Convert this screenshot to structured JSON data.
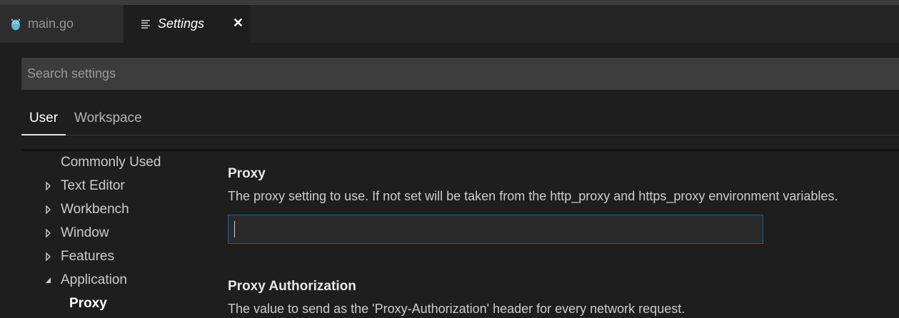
{
  "tabs": {
    "main": {
      "label": "main.go",
      "icon": "go-gopher-icon"
    },
    "settings": {
      "label": "Settings",
      "icon": "settings-lines-icon",
      "close": "✕"
    }
  },
  "search": {
    "placeholder": "Search settings",
    "value": ""
  },
  "scopes": {
    "user": "User",
    "workspace": "Workspace",
    "active": "User"
  },
  "toc": [
    {
      "label": "Commonly Used",
      "expandable": false
    },
    {
      "label": "Text Editor",
      "expandable": true,
      "expanded": false
    },
    {
      "label": "Workbench",
      "expandable": true,
      "expanded": false
    },
    {
      "label": "Window",
      "expandable": true,
      "expanded": false
    },
    {
      "label": "Features",
      "expandable": true,
      "expanded": false
    },
    {
      "label": "Application",
      "expandable": true,
      "expanded": true
    },
    {
      "label": "Proxy",
      "selected": true
    }
  ],
  "settings": [
    {
      "title": "Proxy",
      "description": "The proxy setting to use. If not set will be taken from the http_proxy and https_proxy environment variables.",
      "value": ""
    },
    {
      "title": "Proxy Authorization",
      "description": "The value to send as the 'Proxy-Authorization' header for every network request."
    }
  ],
  "colors": {
    "background": "#1e1e1e",
    "focus_border": "#0e639c",
    "gopher": "#5fb8d6"
  }
}
